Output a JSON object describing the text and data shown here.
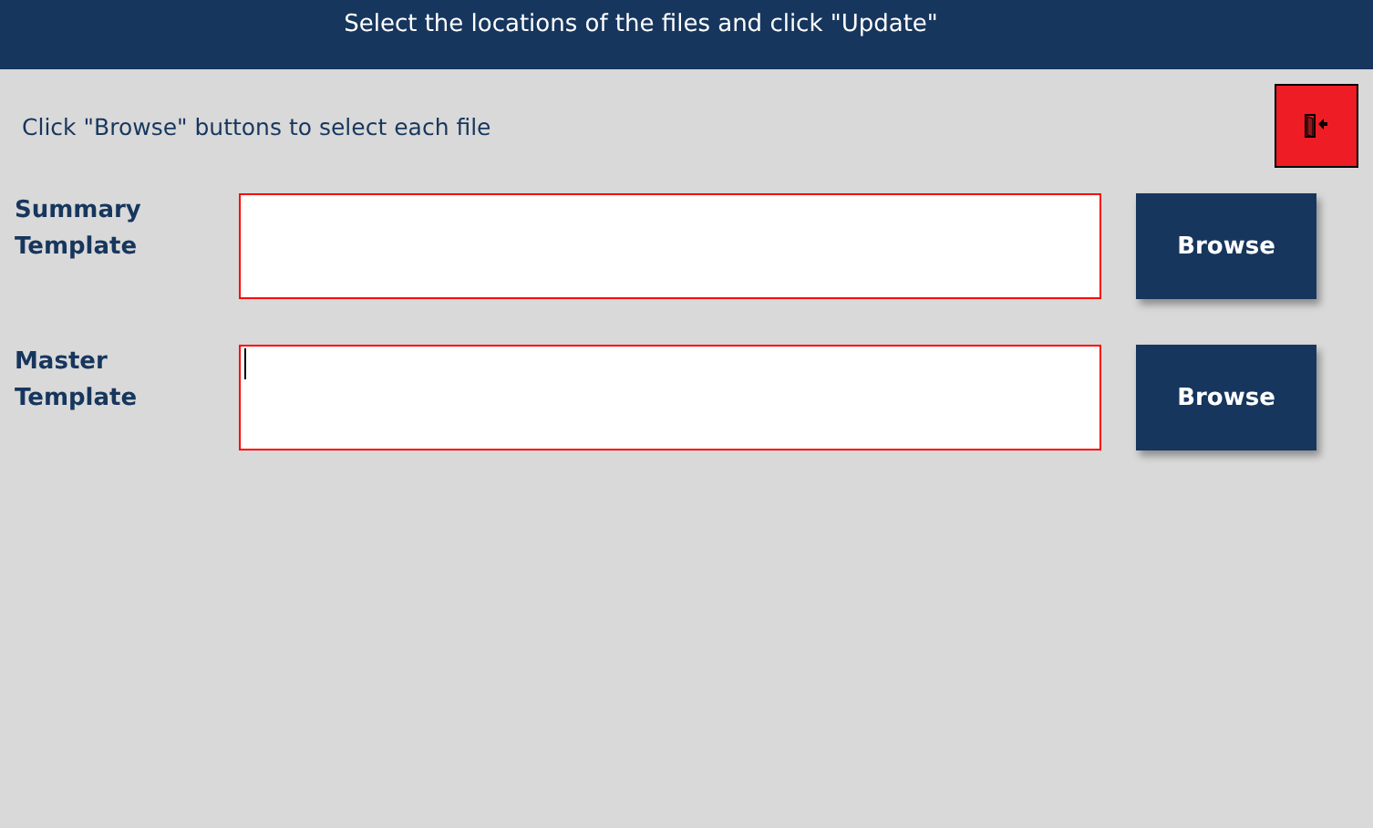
{
  "header": {
    "title": "Select the locations of the files and click \"Update\""
  },
  "instruction": "Click \"Browse\" buttons to select each file",
  "exit_button": {
    "kind": "exit"
  },
  "files": [
    {
      "label": "Summary Template",
      "focused": false,
      "button": "Browse"
    },
    {
      "label": "Master Template",
      "focused": true,
      "button": "Browse"
    }
  ]
}
